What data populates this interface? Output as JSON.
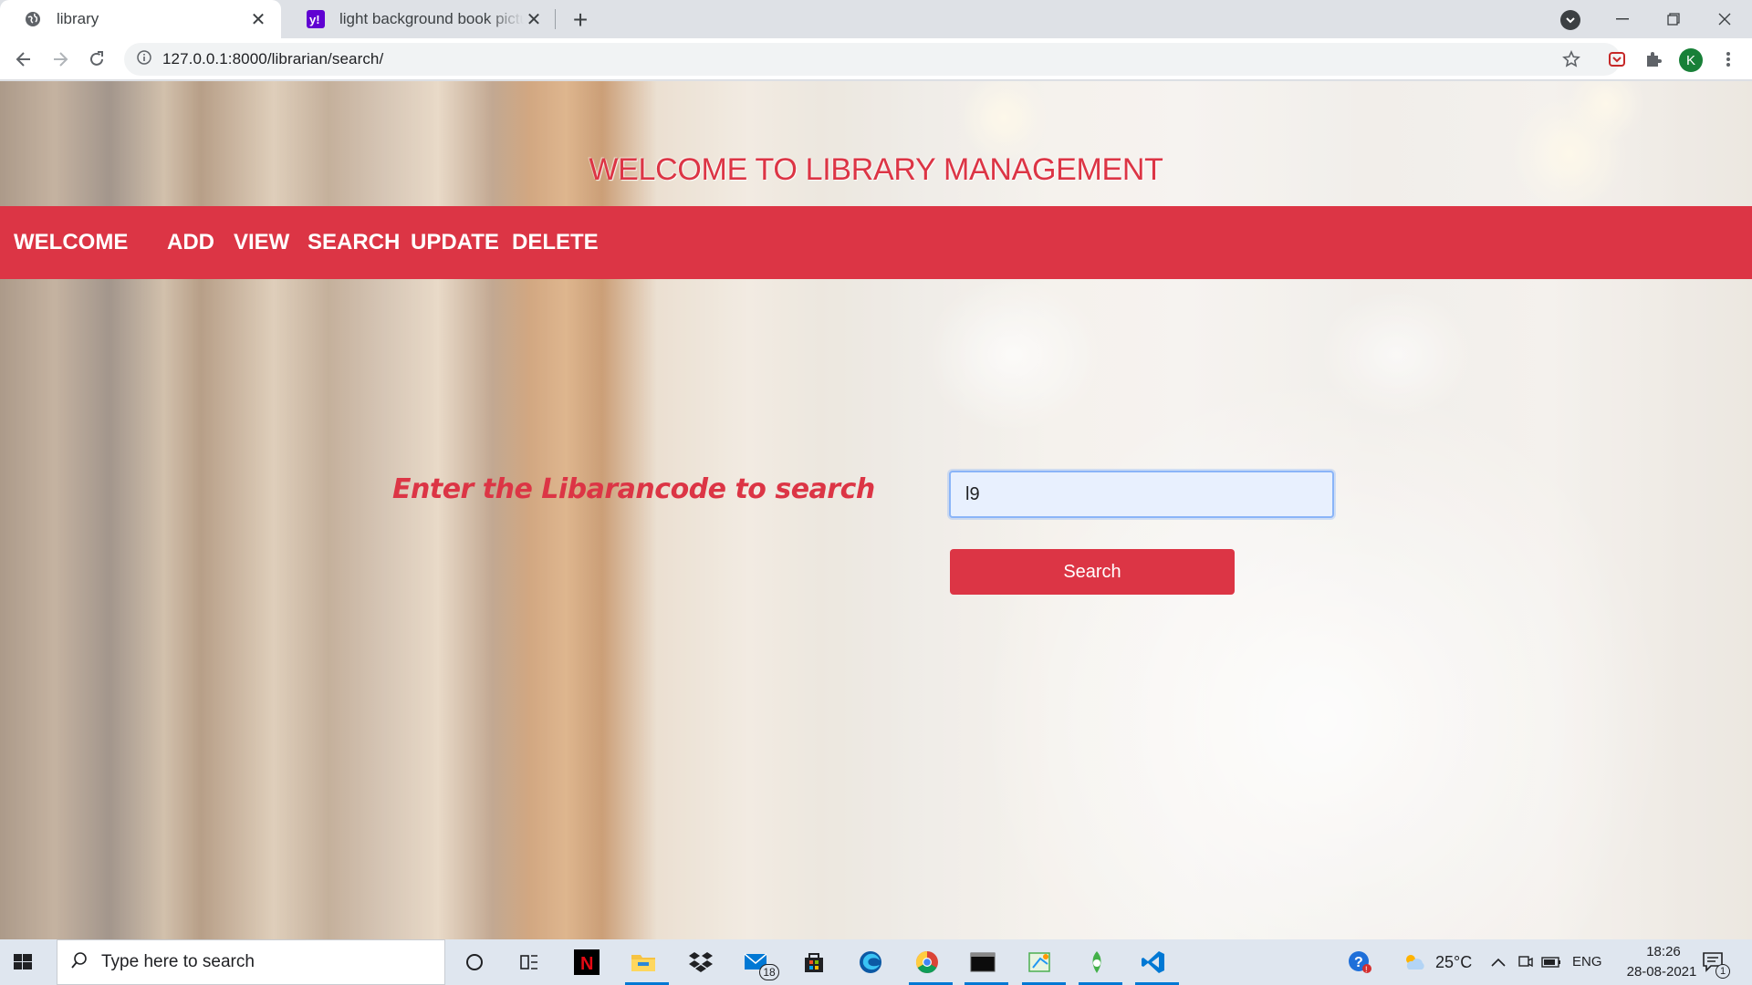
{
  "browser": {
    "tabs": [
      {
        "title": "library",
        "active": true
      },
      {
        "title": "light background book pictures -",
        "active": false
      }
    ],
    "url": "127.0.0.1:8000/librarian/search/",
    "profile_initial": "K"
  },
  "page": {
    "banner_title": "WELCOME TO LIBRARY MANAGEMENT",
    "nav": {
      "brand": "WELCOME",
      "links": [
        "ADD",
        "VIEW",
        "SEARCH",
        "UPDATE",
        "DELETE"
      ]
    },
    "search": {
      "label": "Enter the Libarancode to search",
      "input_value": "l9",
      "button_label": "Search"
    },
    "accent_color": "#dc3545"
  },
  "taskbar": {
    "search_placeholder": "Type here to search",
    "mail_badge": "18",
    "weather": "25°C",
    "language": "ENG",
    "time": "18:26",
    "date": "28-08-2021",
    "notification_count": "1"
  }
}
